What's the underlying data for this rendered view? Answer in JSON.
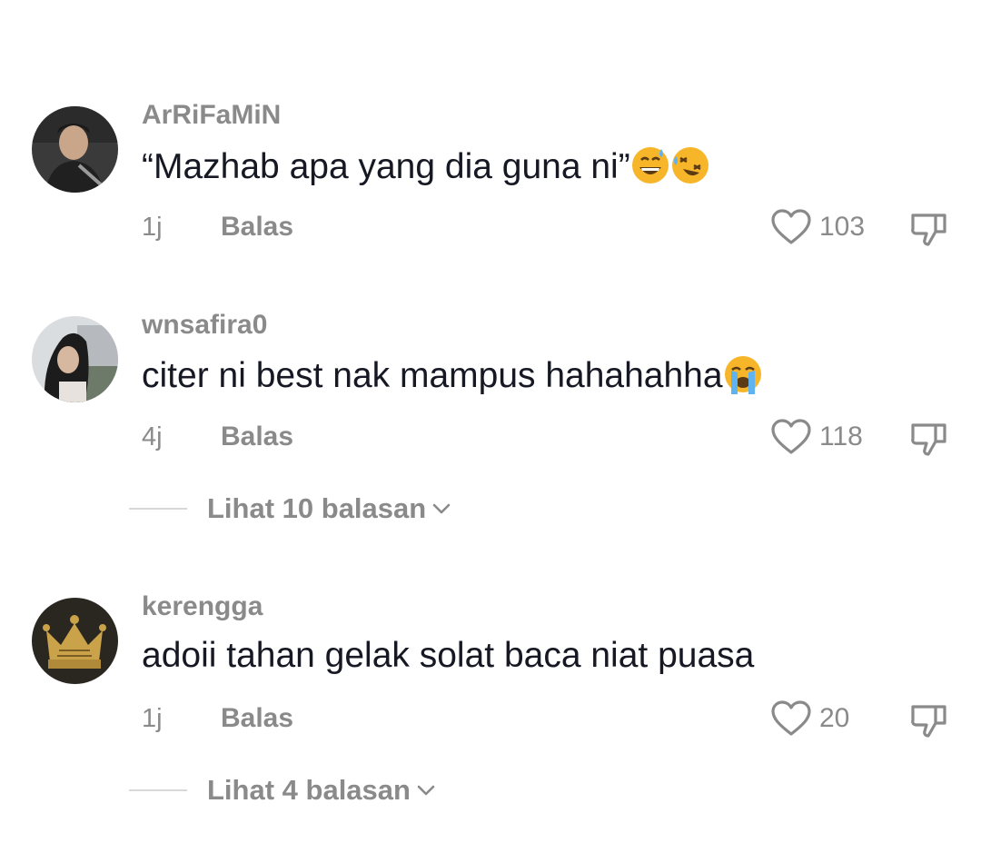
{
  "comments": [
    {
      "username": "ArRiFaMiN",
      "text": "“Mazhab apa yang dia guna ni”",
      "emojis": [
        "grinning-sweat-emoji",
        "rolling-laughing-emoji"
      ],
      "time": "1j",
      "reply_label": "Balas",
      "likes": "103",
      "view_replies": null
    },
    {
      "username": "wnsafira0",
      "text": "citer ni best nak mampus hahahahha",
      "emojis": [
        "loudly-crying-emoji"
      ],
      "time": "4j",
      "reply_label": "Balas",
      "likes": "118",
      "view_replies": "Lihat 10 balasan"
    },
    {
      "username": "kerengga",
      "text": "adoii tahan gelak solat baca niat puasa",
      "emojis": [],
      "time": "1j",
      "reply_label": "Balas",
      "likes": "20",
      "view_replies": "Lihat 4 balasan"
    }
  ],
  "colors": {
    "text_primary": "#161823",
    "text_secondary": "#8a8a8a",
    "divider": "#d8d8d8",
    "emoji_yellow": "#f7b52a"
  },
  "icons": {
    "like": "heart-outline-icon",
    "dislike": "thumbs-down-outline-icon",
    "expand": "chevron-down-icon"
  }
}
